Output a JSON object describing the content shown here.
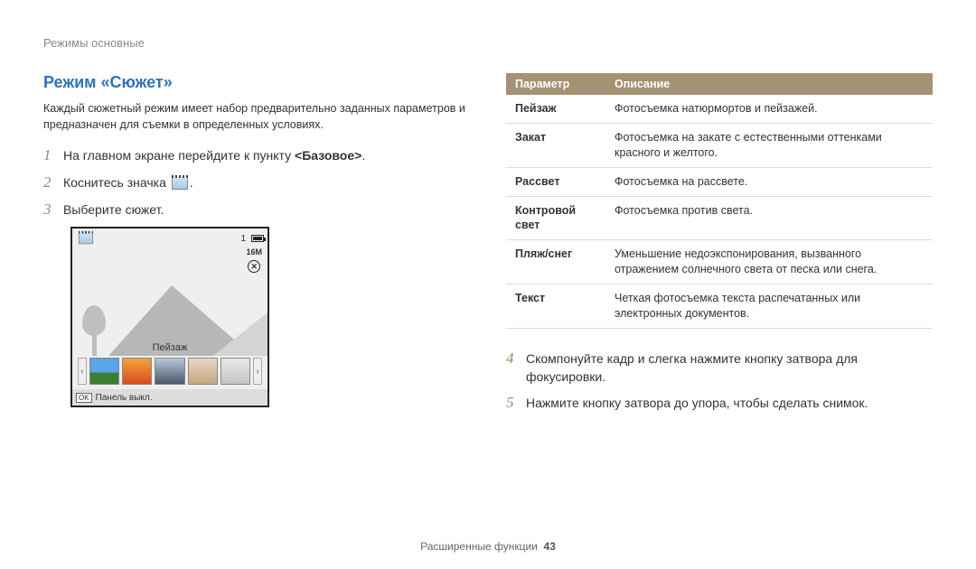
{
  "header": "Режимы основные",
  "section_title": "Режим «Сюжет»",
  "intro": "Каждый сюжетный режим имеет набор предварительно заданных параметров и предназначен для съемки в определенных условиях.",
  "steps": {
    "s1_pre": "На главном экране перейдите к пункту ",
    "s1_bold": "<Базовое>",
    "s1_post": ".",
    "s2_pre": "Коснитесь значка ",
    "s2_post": ".",
    "s3": "Выберите сюжет.",
    "s4": "Скомпонуйте кадр и слегка нажмите кнопку затвора для фокусировки.",
    "s5": "Нажмите кнопку затвора до упора, чтобы сделать снимок."
  },
  "screen": {
    "scn_badge": "SCN",
    "count": "1",
    "res": "16M",
    "mode_label": "Пейзаж",
    "ok": "OK",
    "panel_off": "Панель выкл."
  },
  "table": {
    "head_param": "Параметр",
    "head_desc": "Описание",
    "rows": [
      {
        "p": "Пейзаж",
        "d": "Фотосъемка натюрмортов и пейзажей."
      },
      {
        "p": "Закат",
        "d": "Фотосъемка на закате с естественными оттенками красного и желтого."
      },
      {
        "p": "Рассвет",
        "d": "Фотосъемка на рассвете."
      },
      {
        "p": "Контровой свет",
        "d": "Фотосъемка против света."
      },
      {
        "p": "Пляж/снег",
        "d": "Уменьшение недоэкспонирования, вызванного отражением солнечного света от песка или снега."
      },
      {
        "p": "Текст",
        "d": "Четкая фотосъемка текста распечатанных или электронных документов."
      }
    ]
  },
  "footer": {
    "label": "Расширенные функции",
    "page": "43"
  }
}
